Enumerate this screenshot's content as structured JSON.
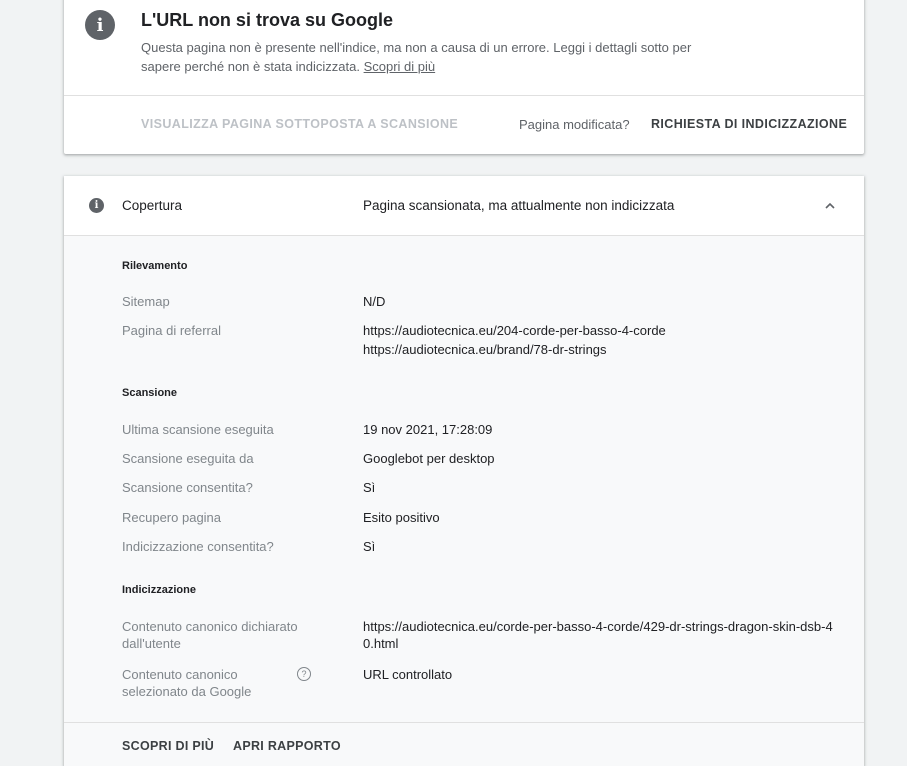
{
  "status": {
    "title": "L'URL non si trova su Google",
    "description": "Questa pagina non è presente nell'indice, ma non a causa di un errore. Leggi i dettagli sotto per sapere perché non è stata indicizzata. ",
    "learn_more": "Scopri di più",
    "view_crawled": "VISUALIZZA PAGINA SOTTOPOSTA A SCANSIONE",
    "modified_question": "Pagina modificata?",
    "request_indexing": "RICHIESTA DI INDICIZZAZIONE"
  },
  "coverage": {
    "label": "Copertura",
    "value": "Pagina scansionata, ma attualmente non indicizzata",
    "sections": {
      "discovery": {
        "title": "Rilevamento",
        "sitemap_label": "Sitemap",
        "sitemap_value": "N/D",
        "referral_label": "Pagina di referral",
        "referral_value_1": "https://audiotecnica.eu/204-corde-per-basso-4-corde",
        "referral_value_2": "https://audiotecnica.eu/brand/78-dr-strings"
      },
      "crawl": {
        "title": "Scansione",
        "last_crawl_label": "Ultima scansione eseguita",
        "last_crawl_value": "19 nov 2021, 17:28:09",
        "crawled_as_label": "Scansione eseguita da",
        "crawled_as_value": "Googlebot per desktop",
        "crawl_allowed_label": "Scansione consentita?",
        "crawl_allowed_value": "Sì",
        "page_fetch_label": "Recupero pagina",
        "page_fetch_value": "Esito positivo",
        "indexing_allowed_label": "Indicizzazione consentita?",
        "indexing_allowed_value": "Sì"
      },
      "indexing": {
        "title": "Indicizzazione",
        "user_canonical_label": "Contenuto canonico dichiarato dall'utente",
        "user_canonical_value": "https://audiotecnica.eu/corde-per-basso-4-corde/429-dr-strings-dragon-skin-dsb-40.html",
        "google_canonical_label": "Contenuto canonico selezionato da Google",
        "google_canonical_value": "URL controllato"
      }
    },
    "footer": {
      "learn_more": "SCOPRI DI PIÙ",
      "open_report": "APRI RAPPORTO"
    }
  }
}
